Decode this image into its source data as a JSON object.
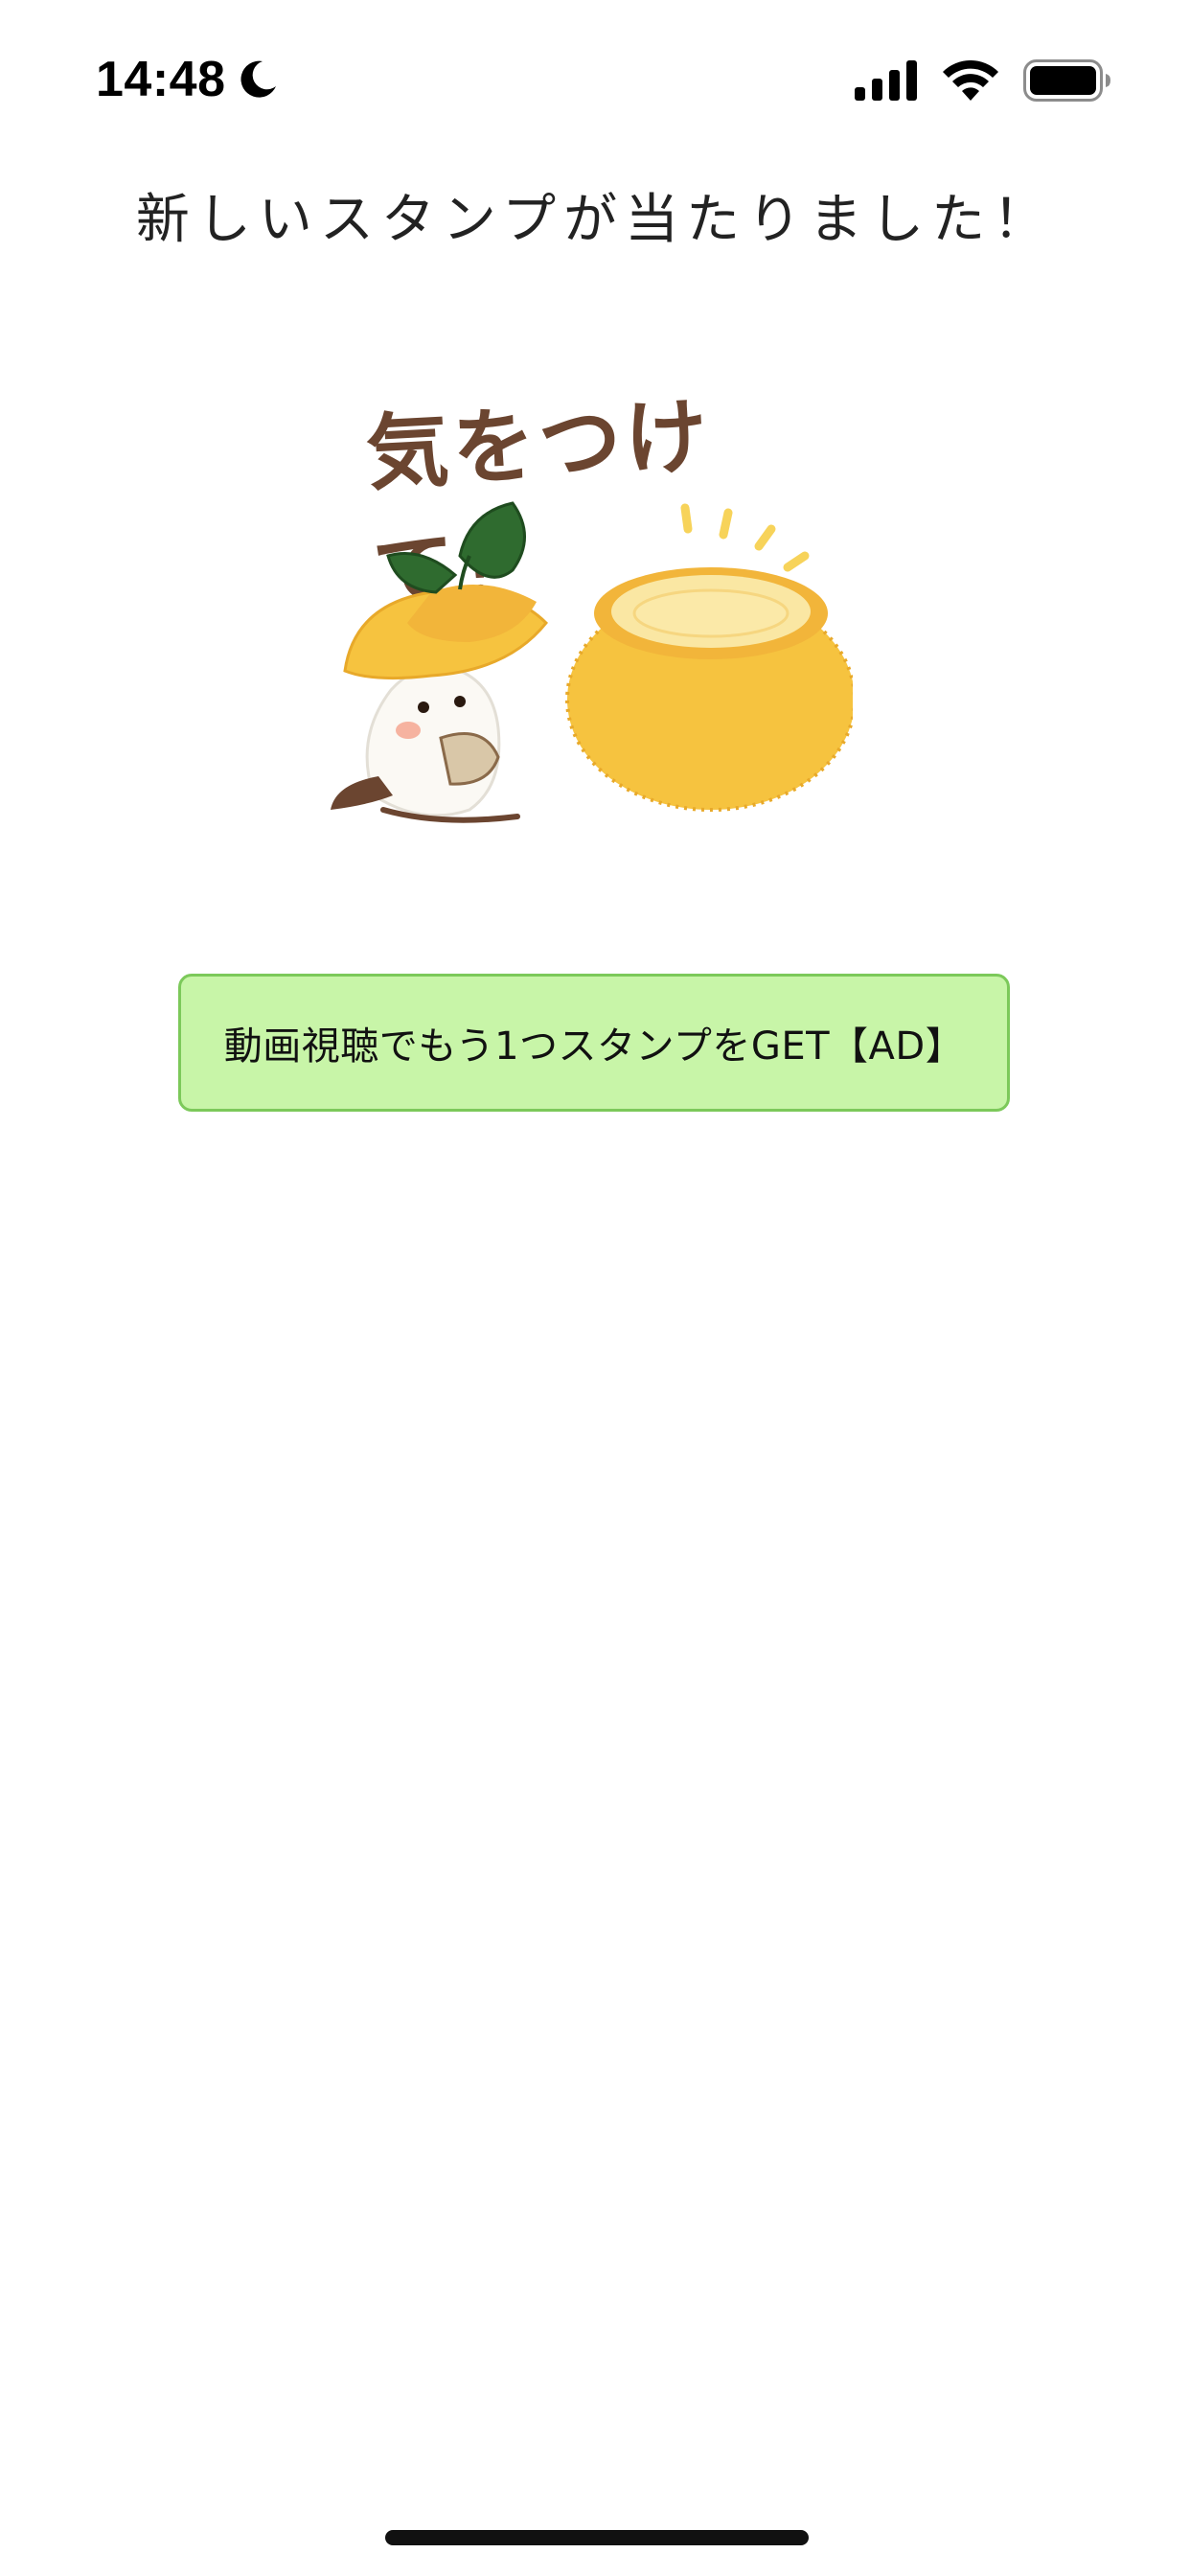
{
  "status_bar": {
    "time": "14:48",
    "focus_icon": "moon-icon",
    "signal_icon": "cellular-signal-icon",
    "wifi_icon": "wifi-icon",
    "battery_icon": "battery-icon"
  },
  "page": {
    "title": "新しいスタンプが当たりました！"
  },
  "sticker": {
    "caption": "気をつけて！",
    "description_icon": "bird-with-orange-bowl-sticker"
  },
  "ad_button": {
    "label": "動画視聴でもう1つスタンプをGET【AD】",
    "background": "#c8f5a8",
    "border": "#7cc95a"
  },
  "colors": {
    "background": "#ffffff",
    "text": "#222222",
    "sticker_text": "#6b4530",
    "orange": "#f6c33f",
    "leaf": "#2f6b2f"
  }
}
